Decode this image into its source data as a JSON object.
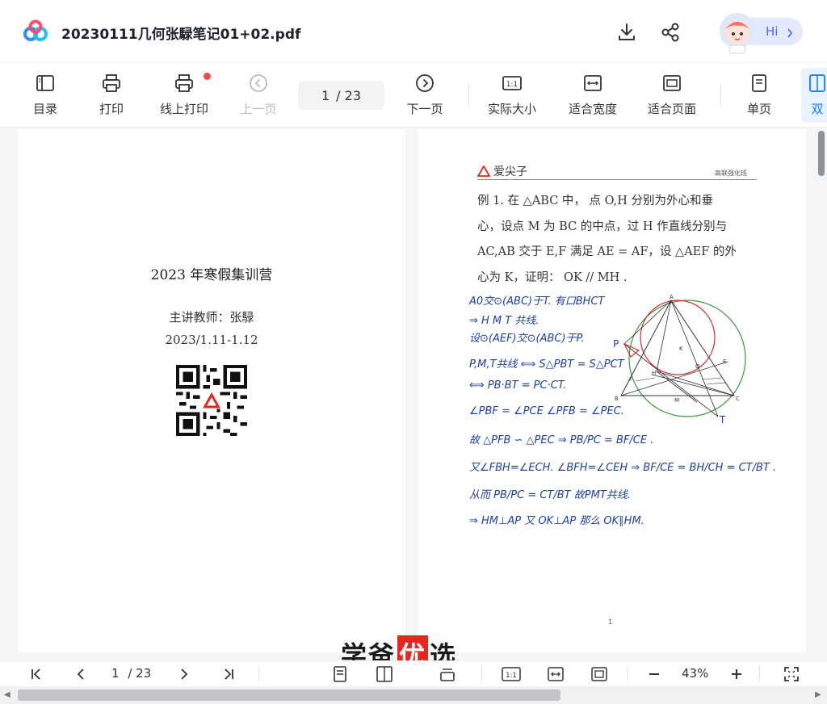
{
  "header": {
    "file_title": "20230111几何张騄笔记01+02.pdf",
    "hi_label": "Hi",
    "icons": [
      "download-icon",
      "share-icon"
    ]
  },
  "toolbar": {
    "catalog": "目录",
    "print": "打印",
    "online_print": "线上打印",
    "prev_page": "上一页",
    "page_current": "1",
    "page_total": "/ 23",
    "next_page": "下一页",
    "actual_size": "实际大小",
    "fit_width": "适合宽度",
    "fit_page": "适合页面",
    "single_page": "单页",
    "double_page": "双"
  },
  "left_page": {
    "camp_title": "2023 年寒假集训营",
    "teacher": "主讲教师：张騄",
    "date": "2023/1.11-1.12"
  },
  "right_page": {
    "brand": "爱尖子",
    "brand_right": "高联强化班",
    "problem_lines": [
      "例 1.  在 △ABC 中， 点 O,H 分别为外心和垂",
      "心，设点 M 为 BC 的中点，过 H 作直线分别与",
      "AC,AB 交于 E,F 满足 AE = AF，设 △AEF 的外",
      "心为 K，证明： OK // MH ."
    ],
    "handwriting": [
      "A0交⊙(ABC)于T. 有口BHCT",
      "⇒ H M T 共线.",
      "设⊙(AEF)交⊙(ABC)于P.",
      "P,M,T共线 ⟺ S△PBT = S△PCT",
      "⟺ PB·BT = PC·CT.",
      "∠PBF = ∠PCE   ∠PFB = ∠PEC.",
      "故 △PFB ∽ △PEC ⇒ PB/PC = BF/CE .",
      "又∠FBH=∠ECH. ∠BFH=∠CEH ⇒ BF/CE = BH/CH = CT/BT .",
      "从而 PB/PC = CT/BT    故PMT共线.",
      "⇒ HM⊥AP   又 OK⊥AP   那么 OK∥HM."
    ],
    "figure_labels": [
      "A",
      "P",
      "K",
      "O",
      "E",
      "F",
      "H",
      "B",
      "M",
      "C",
      "T"
    ],
    "page_number": "1"
  },
  "watermark": {
    "part1": "学爸",
    "part2": "优",
    "part3": "选"
  },
  "bottombar": {
    "page_current": "1",
    "page_total": "/ 23",
    "zoom": "43%"
  }
}
